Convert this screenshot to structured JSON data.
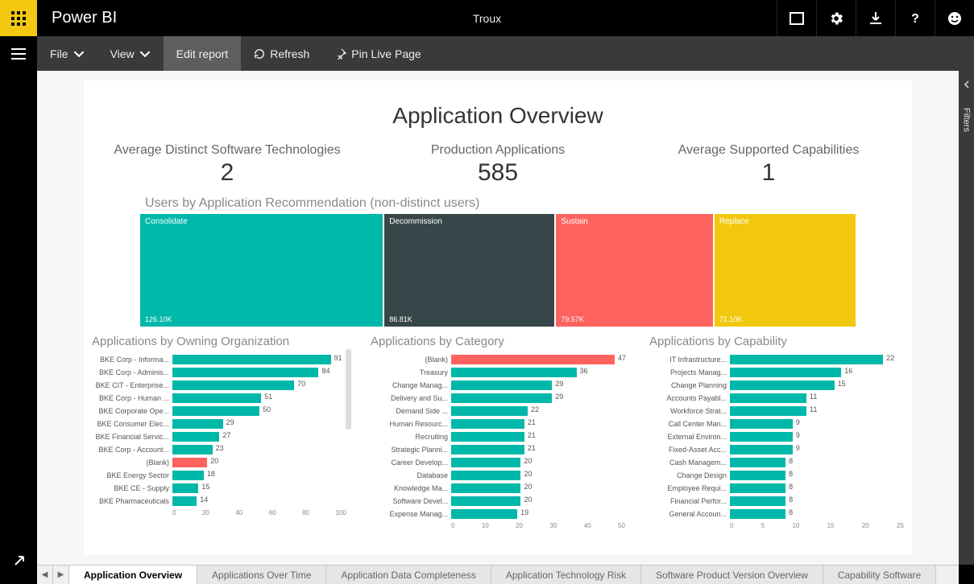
{
  "brand": "Power BI",
  "workspace": "Troux",
  "menu": {
    "file": "File",
    "view": "View",
    "edit_report": "Edit report",
    "refresh": "Refresh",
    "pin_live": "Pin Live Page"
  },
  "filters_label": "Filters",
  "page_title": "Application Overview",
  "kpis": [
    {
      "label": "Average Distinct Software Technologies",
      "value": "2"
    },
    {
      "label": "Production Applications",
      "value": "585"
    },
    {
      "label": "Average Supported Capabilities",
      "value": "1"
    }
  ],
  "treemap": {
    "title": "Users by Application Recommendation (non-distinct users)",
    "cells": [
      {
        "label": "Consolidate",
        "value_label": "126.10K",
        "weight": 126.1,
        "color": "#00b8aa"
      },
      {
        "label": "Decommission",
        "value_label": "86.81K",
        "weight": 86.81,
        "color": "#374649"
      },
      {
        "label": "Sustain",
        "value_label": "79.57K",
        "weight": 79.57,
        "color": "#fd625e"
      },
      {
        "label": "Replace",
        "value_label": "71.10K",
        "weight": 71.1,
        "color": "#f2c80f"
      }
    ]
  },
  "bar_charts": [
    {
      "title": "Applications by Owning Organization",
      "max": 100,
      "ticks": [
        "0",
        "20",
        "40",
        "60",
        "80",
        "100"
      ],
      "bars": [
        {
          "cat": "BKE Corp - Informa...",
          "val": 91
        },
        {
          "cat": "BKE Corp - Adminis...",
          "val": 84
        },
        {
          "cat": "BKE CIT - Enterprise...",
          "val": 70
        },
        {
          "cat": "BKE Corp - Human ...",
          "val": 51
        },
        {
          "cat": "BKE Corporate Ope...",
          "val": 50
        },
        {
          "cat": "BKE Consumer Elec...",
          "val": 29
        },
        {
          "cat": "BKE Financial Servic...",
          "val": 27
        },
        {
          "cat": "BKE Corp - Account...",
          "val": 23
        },
        {
          "cat": "(Blank)",
          "val": 20,
          "red": true
        },
        {
          "cat": "BKE Energy Sector",
          "val": 18
        },
        {
          "cat": "BKE CE - Supply",
          "val": 15
        },
        {
          "cat": "BKE Pharmaceuticals",
          "val": 14
        }
      ]
    },
    {
      "title": "Applications by Category",
      "max": 50,
      "ticks": [
        "0",
        "10",
        "20",
        "30",
        "40",
        "50"
      ],
      "bars": [
        {
          "cat": "(Blank)",
          "val": 47,
          "red": true
        },
        {
          "cat": "Treasury",
          "val": 36
        },
        {
          "cat": "Change Manag...",
          "val": 29
        },
        {
          "cat": "Delivery and Su...",
          "val": 29
        },
        {
          "cat": "Demand Side ...",
          "val": 22
        },
        {
          "cat": "Human Resourc...",
          "val": 21
        },
        {
          "cat": "Recruiting",
          "val": 21
        },
        {
          "cat": "Strategic Planni...",
          "val": 21
        },
        {
          "cat": "Career Develop...",
          "val": 20
        },
        {
          "cat": "Database",
          "val": 20
        },
        {
          "cat": "Knowledge Ma...",
          "val": 20
        },
        {
          "cat": "Software Devel...",
          "val": 20
        },
        {
          "cat": "Expense Manag...",
          "val": 19
        }
      ]
    },
    {
      "title": "Applications by Capability",
      "max": 25,
      "ticks": [
        "0",
        "5",
        "10",
        "15",
        "20",
        "25"
      ],
      "bars": [
        {
          "cat": "IT Infrastructure...",
          "val": 22
        },
        {
          "cat": "Projects Manag...",
          "val": 16
        },
        {
          "cat": "Change Planning",
          "val": 15
        },
        {
          "cat": "Accounts Payabl...",
          "val": 11
        },
        {
          "cat": "Workforce Strat...",
          "val": 11
        },
        {
          "cat": "Call Center Man...",
          "val": 9
        },
        {
          "cat": "External Environ...",
          "val": 9
        },
        {
          "cat": "Fixed-Asset Acc...",
          "val": 9
        },
        {
          "cat": "Cash Managem...",
          "val": 8
        },
        {
          "cat": "Change Design",
          "val": 8
        },
        {
          "cat": "Employee Requi...",
          "val": 8
        },
        {
          "cat": "Financial Perfor...",
          "val": 8
        },
        {
          "cat": "General Accoun...",
          "val": 8
        }
      ]
    }
  ],
  "tabs": [
    "Application Overview",
    "Applications Over Time",
    "Application Data Completeness",
    "Application Technology Risk",
    "Software Product Version Overview",
    "Capability Software"
  ],
  "chart_data": {
    "treemap": {
      "type": "treemap",
      "title": "Users by Application Recommendation (non-distinct users)",
      "series": [
        {
          "name": "Users",
          "values": [
            126100,
            86810,
            79570,
            71100
          ]
        }
      ],
      "categories": [
        "Consolidate",
        "Decommission",
        "Sustain",
        "Replace"
      ]
    },
    "bar_owning_org": {
      "type": "bar",
      "title": "Applications by Owning Organization",
      "xlabel": "",
      "ylabel": "",
      "ylim": [
        0,
        100
      ],
      "categories": [
        "BKE Corp - Information",
        "BKE Corp - Administration",
        "BKE CIT - Enterprise",
        "BKE Corp - Human",
        "BKE Corporate Operations",
        "BKE Consumer Electronics",
        "BKE Financial Services",
        "BKE Corp - Accounting",
        "(Blank)",
        "BKE Energy Sector",
        "BKE CE - Supply",
        "BKE Pharmaceuticals"
      ],
      "values": [
        91,
        84,
        70,
        51,
        50,
        29,
        27,
        23,
        20,
        18,
        15,
        14
      ]
    },
    "bar_category": {
      "type": "bar",
      "title": "Applications by Category",
      "xlabel": "",
      "ylabel": "",
      "ylim": [
        0,
        50
      ],
      "categories": [
        "(Blank)",
        "Treasury",
        "Change Management",
        "Delivery and Support",
        "Demand Side",
        "Human Resources",
        "Recruiting",
        "Strategic Planning",
        "Career Development",
        "Database",
        "Knowledge Management",
        "Software Development",
        "Expense Management"
      ],
      "values": [
        47,
        36,
        29,
        29,
        22,
        21,
        21,
        21,
        20,
        20,
        20,
        20,
        19
      ]
    },
    "bar_capability": {
      "type": "bar",
      "title": "Applications by Capability",
      "xlabel": "",
      "ylabel": "",
      "ylim": [
        0,
        25
      ],
      "categories": [
        "IT Infrastructure",
        "Projects Management",
        "Change Planning",
        "Accounts Payable",
        "Workforce Strategy",
        "Call Center Management",
        "External Environment",
        "Fixed-Asset Accounting",
        "Cash Management",
        "Change Design",
        "Employee Requisition",
        "Financial Performance",
        "General Accounting"
      ],
      "values": [
        22,
        16,
        15,
        11,
        11,
        9,
        9,
        9,
        8,
        8,
        8,
        8,
        8
      ]
    }
  }
}
